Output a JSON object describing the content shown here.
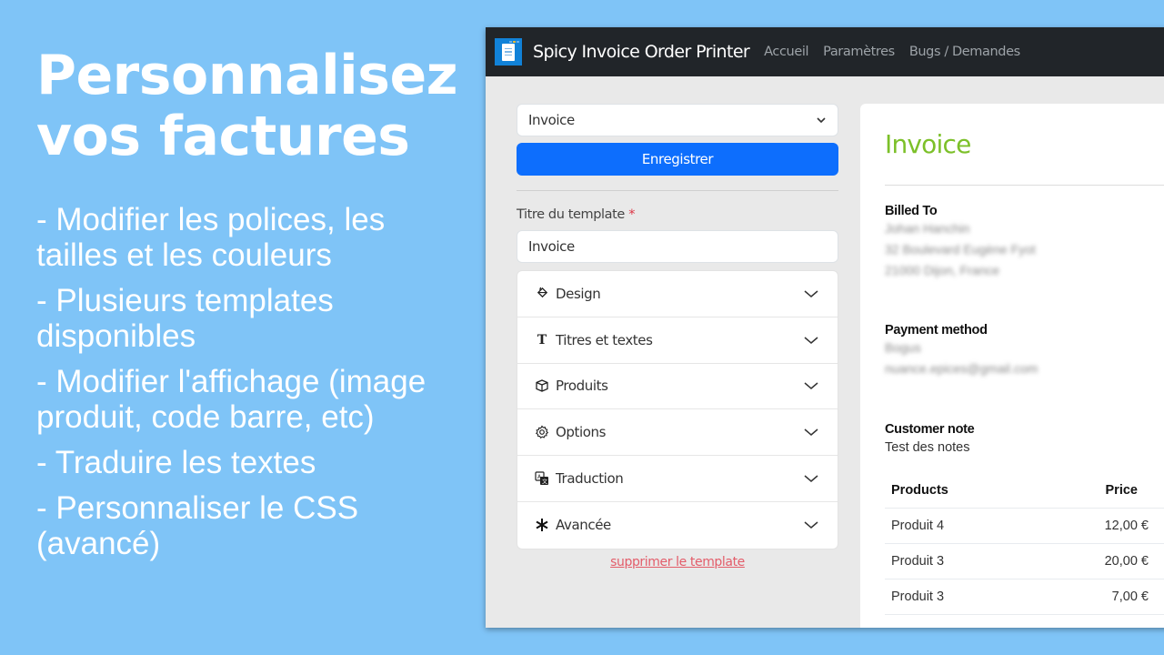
{
  "promo": {
    "title_line1": "Personnalisez",
    "title_line2": "vos factures",
    "features": [
      "- Modifier les polices, les tailles et les couleurs",
      "- Plusieurs templates disponibles",
      "- Modifier l'affichage (image produit, code barre, etc)",
      "- Traduire les textes",
      "- Personnaliser le CSS (avancé)"
    ]
  },
  "navbar": {
    "logo_icon": "receipt-icon",
    "brand": "Spicy Invoice Order Printer",
    "links": [
      "Accueil",
      "Paramètres",
      "Bugs / Demandes"
    ]
  },
  "form": {
    "template_select_value": "Invoice",
    "save_label": "Enregistrer",
    "title_label": "Titre du template",
    "required_mark": "*",
    "title_value": "Invoice",
    "sections": [
      {
        "label": "Design",
        "icon": "paint-bucket-icon"
      },
      {
        "label": "Titres et textes",
        "icon": "type-icon"
      },
      {
        "label": "Produits",
        "icon": "box-icon"
      },
      {
        "label": "Options",
        "icon": "gear-icon"
      },
      {
        "label": "Traduction",
        "icon": "translate-icon"
      },
      {
        "label": "Avancée",
        "icon": "asterisk-icon"
      }
    ],
    "delete_label": "supprimer le template"
  },
  "preview": {
    "title": "Invoice",
    "accent_color": "#7cc029",
    "billed_to_heading": "Billed To",
    "billed_to_lines": [
      "Johan Hanchin",
      "32 Boulevard Eugène Fyot",
      "21000 Dijon, France"
    ],
    "payment_heading": "Payment method",
    "payment_lines": [
      "Bogus",
      "nuance.epices@gmail.com"
    ],
    "note_heading": "Customer note",
    "note_text": "Test des notes",
    "table": {
      "headers": [
        "Products",
        "Price"
      ],
      "rows": [
        [
          "Produit 4",
          "12,00 €"
        ],
        [
          "Produit 3",
          "20,00 €"
        ],
        [
          "Produit 3",
          "7,00 €"
        ]
      ]
    }
  }
}
